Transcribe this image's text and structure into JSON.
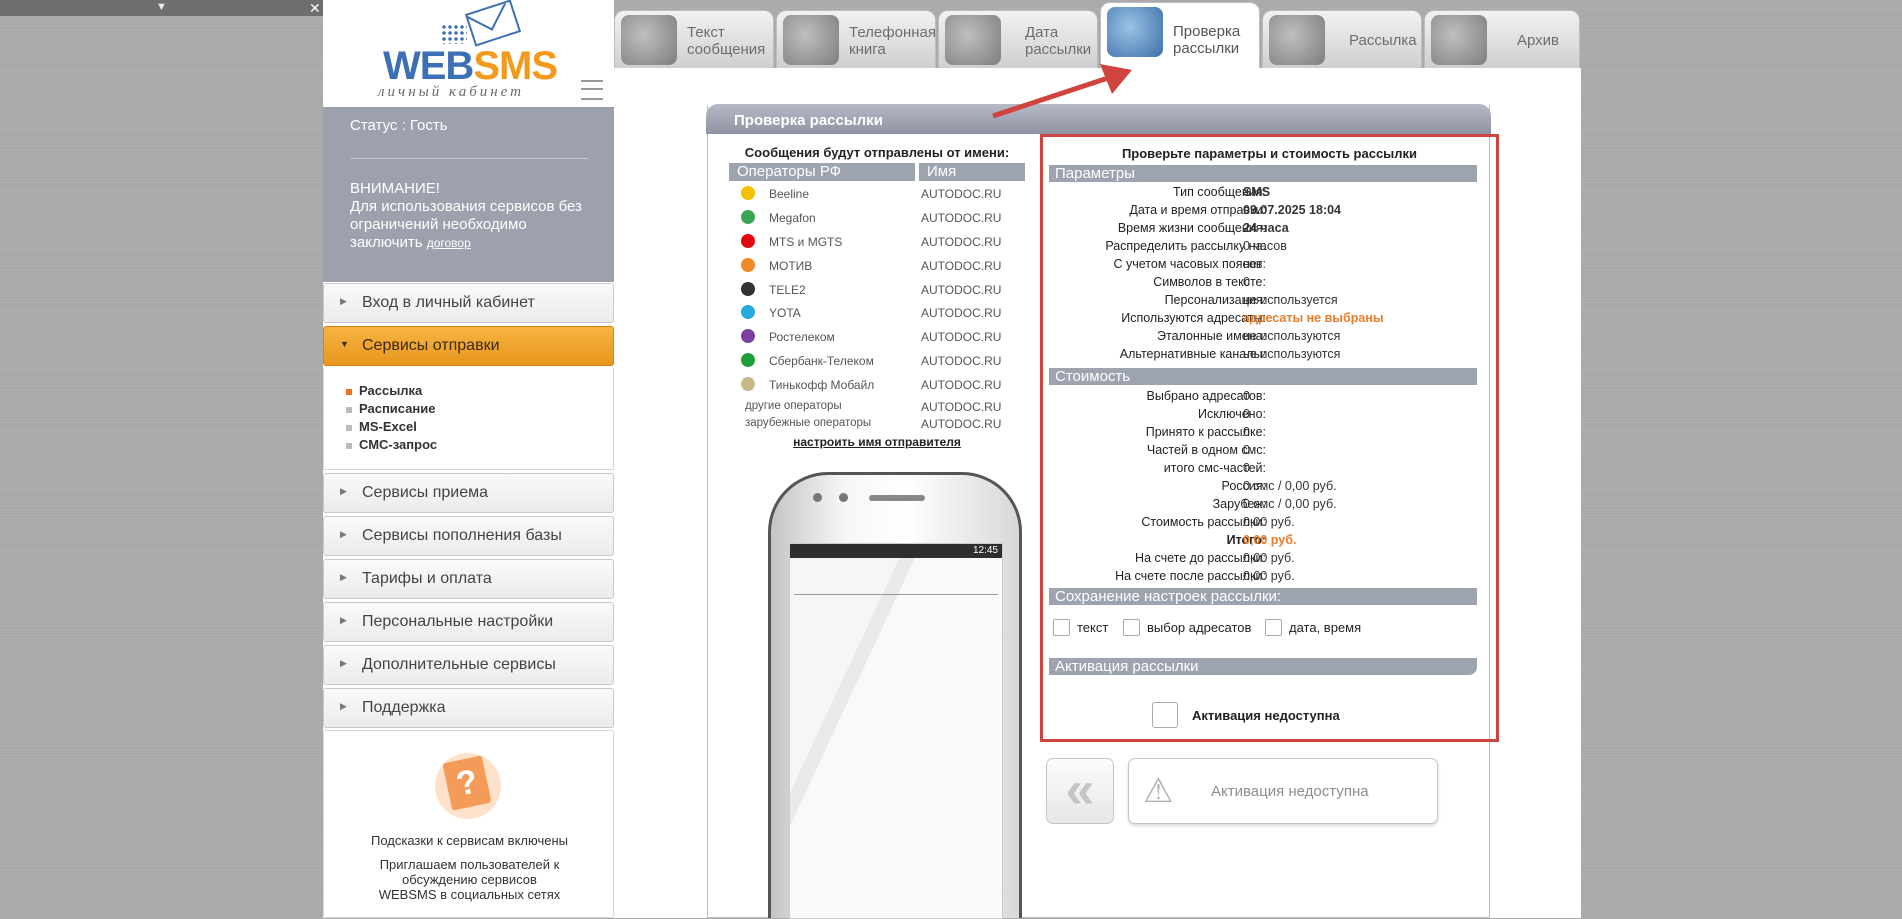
{
  "app": {
    "logo_text_a": "WEB",
    "logo_text_b": "SMS",
    "logo_sub": "личный кабинет"
  },
  "status": {
    "label": "Статус : Гость",
    "warning_title": "ВНИМАНИЕ!",
    "warning_text": "Для использования сервисов без ограничений необходимо заключить",
    "warning_link": "договор"
  },
  "sidebar": {
    "items": [
      {
        "label": "Вход в личный кабинет"
      },
      {
        "label": "Сервисы отправки"
      },
      {
        "label": "Сервисы приема"
      },
      {
        "label": "Сервисы пополнения базы"
      },
      {
        "label": "Тарифы и оплата"
      },
      {
        "label": "Персональные настройки"
      },
      {
        "label": "Дополнительные сервисы"
      },
      {
        "label": "Поддержка"
      }
    ],
    "submenu": [
      {
        "label": "Рассылка"
      },
      {
        "label": "Расписание"
      },
      {
        "label": "MS-Excel"
      },
      {
        "label": "СМС-запрос"
      }
    ],
    "help_title": "Подсказки к сервисам включены",
    "help_text": "Приглашаем пользователей к обсуждению сервисов WEBSMS в социальных сетях",
    "help_icon": "?"
  },
  "tabs": [
    {
      "label": "Текст сообщения"
    },
    {
      "label": "Телефонная книга"
    },
    {
      "label": "Дата рассылки"
    },
    {
      "label": "Проверка рассылки"
    },
    {
      "label": "Рассылка"
    },
    {
      "label": "Архив"
    }
  ],
  "panel": {
    "title": "Проверка рассылки",
    "senders_caption": "Сообщения будут отправлены от имени:",
    "col_operators": "Операторы РФ",
    "col_name": "Имя",
    "operators": [
      {
        "name": "Beeline",
        "value": "AUTODOC.RU",
        "color": "#f2c200"
      },
      {
        "name": "Megafon",
        "value": "AUTODOC.RU",
        "color": "#3aa655"
      },
      {
        "name": "MTS и MGTS",
        "value": "AUTODOC.RU",
        "color": "#e30611"
      },
      {
        "name": "МОТИВ",
        "value": "AUTODOC.RU",
        "color": "#f08a24"
      },
      {
        "name": "TELE2",
        "value": "AUTODOC.RU",
        "color": "#333333"
      },
      {
        "name": "YOTA",
        "value": "AUTODOC.RU",
        "color": "#2aa8e0"
      },
      {
        "name": "Ростелеком",
        "value": "AUTODOC.RU",
        "color": "#7b3fa0"
      },
      {
        "name": "Сбербанк-Телеком",
        "value": "AUTODOC.RU",
        "color": "#21a038"
      },
      {
        "name": "Тинькофф Мобайл",
        "value": "AUTODOC.RU",
        "color": "#c9b98a"
      },
      {
        "name": "другие операторы",
        "value": "AUTODOC.RU",
        "color": ""
      },
      {
        "name": "зарубежные операторы",
        "value": "AUTODOC.RU",
        "color": ""
      }
    ],
    "configure_link": "настроить имя отправителя",
    "phone_time": "12:45"
  },
  "params": {
    "caption": "Проверьте параметры и стоимость рассылки",
    "section_params": "Параметры",
    "rows": [
      {
        "k": "Тип сообщения:",
        "v": "SMS"
      },
      {
        "k": "Дата и время отправки:",
        "v": "09.07.2025 18:04"
      },
      {
        "k": "Время жизни сообщения:",
        "v": "24 часа"
      },
      {
        "k": "Распределить рассылку на:",
        "v": "0 часов"
      },
      {
        "k": "С учетом часовых поясов:",
        "v": "нет"
      },
      {
        "k": "Символов в тексте:",
        "v": "0"
      },
      {
        "k": "Персонализация:",
        "v": "не используется"
      },
      {
        "k": "Используются адресаты:",
        "v": "адресаты не выбраны"
      },
      {
        "k": "Эталонные имена:",
        "v": "не используются"
      },
      {
        "k": "Альтернативные каналы:",
        "v": "не используются"
      }
    ],
    "section_cost": "Стоимость",
    "cost_rows": [
      {
        "k": "Выбрано адресатов:",
        "v": "0"
      },
      {
        "k": "Исключено:",
        "v": "0"
      },
      {
        "k": "Принято к рассылке:",
        "v": "0"
      },
      {
        "k": "Частей в одном смс:",
        "v": "0"
      },
      {
        "k": "итого смс-частей:",
        "v": "0"
      },
      {
        "k": "Россия:",
        "v": "0 смс / 0,00 руб."
      },
      {
        "k": "Зарубеж:",
        "v": "0 смс / 0,00 руб."
      },
      {
        "k": "Стоимость рассылки:",
        "v": "0,00 руб."
      },
      {
        "k": "Итого:",
        "v": "0,00 руб."
      },
      {
        "k": "На счете до рассылки:",
        "v": "0,00 руб."
      },
      {
        "k": "На счете после рассылки:",
        "v": "0,00 руб."
      }
    ],
    "section_save": "Сохранение настроек рассылки:",
    "save_text": "текст",
    "save_recipients": "выбор адресатов",
    "save_datetime": "дата, время",
    "section_activate": "Активация рассылки",
    "activation_label": "Активация недоступна"
  },
  "buttons": {
    "back_label": "«",
    "activate_label": "Активация недоступна",
    "warning_glyph": "⚠"
  },
  "colors": {
    "accent_orange": "#f39a1d",
    "highlight_red": "#d0443f",
    "brand_blue": "#3c6fb4"
  }
}
